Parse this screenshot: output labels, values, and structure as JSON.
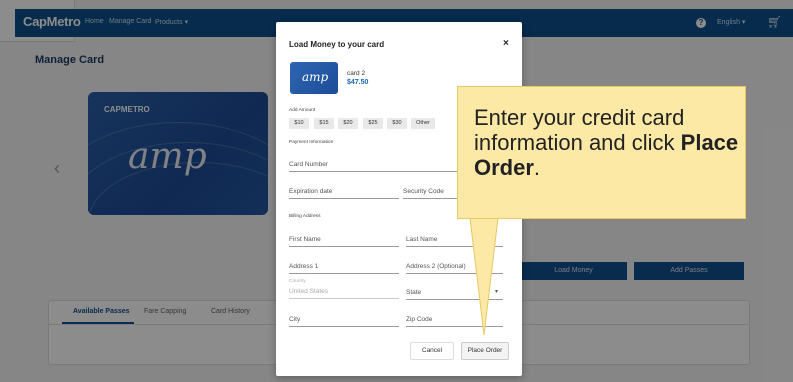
{
  "header": {
    "logo": "CapMetro",
    "nav": {
      "home": "Home",
      "manage_card": "Manage Card",
      "products": "Products ▾"
    },
    "language": "English ▾"
  },
  "page": {
    "title": "Manage Card",
    "card_brand": "CAPMETRO",
    "card_word": "amp",
    "buttons": {
      "load_money": "Load Money",
      "add_passes": "Add Passes"
    },
    "tabs": [
      "Available Passes",
      "Fare Capping",
      "Card History"
    ]
  },
  "modal": {
    "title": "Load Money to your card",
    "close": "×",
    "card": {
      "name": "card 2",
      "balance": "$47.50",
      "mini_word": "amp"
    },
    "add_amount_label": "Add Amount",
    "amounts": [
      "$10",
      "$15",
      "$20",
      "$25",
      "$30",
      "Other"
    ],
    "payment_label": "Payment Information",
    "fields": {
      "card_number": "Card Number",
      "expiration": "Expiration date",
      "security_code": "Security Code",
      "first_name": "First Name",
      "last_name": "Last Name",
      "address1": "Address 1",
      "address2": "Address 2 (Optional)",
      "country_label": "Country",
      "country_value": "United States",
      "state": "State",
      "city": "City",
      "zip": "Zip Code"
    },
    "billing_label": "Billing Address",
    "buttons": {
      "cancel": "Cancel",
      "place_order": "Place Order"
    }
  },
  "callout": {
    "text_before": "Enter your credit card information and click ",
    "text_bold": "Place Order",
    "text_after": "."
  },
  "colors": {
    "brand": "#0b4f8a",
    "accent": "#1766b4",
    "callout_bg": "#fde9a6"
  }
}
